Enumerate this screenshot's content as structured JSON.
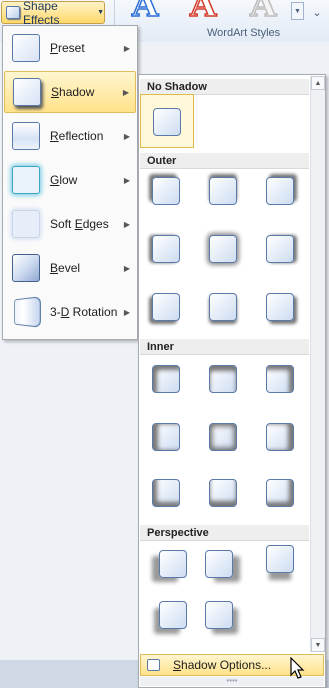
{
  "ribbon": {
    "shape_effects_label": "Shape Effects",
    "wordart_group_label": "WordArt Styles",
    "wordart_letters": [
      "A",
      "A",
      "A"
    ]
  },
  "menu": {
    "items": [
      {
        "label": "Preset",
        "access_key": "P",
        "rest": "reset",
        "icon": "preset-icon"
      },
      {
        "label": "Shadow",
        "access_key": "S",
        "rest": "hadow",
        "icon": "shadow-icon"
      },
      {
        "label": "Reflection",
        "access_key": "R",
        "rest": "eflection",
        "icon": "reflection-icon"
      },
      {
        "label": "Glow",
        "access_key": "G",
        "rest": "low",
        "icon": "glow-icon"
      },
      {
        "label": "Soft Edges",
        "pre": "Soft ",
        "access_key": "E",
        "rest": "dges",
        "icon": "soft-edges-icon"
      },
      {
        "label": "Bevel",
        "access_key": "B",
        "rest": "evel",
        "icon": "bevel-icon"
      },
      {
        "label": "3-D Rotation",
        "pre": "3-",
        "access_key": "D",
        "rest": " Rotation",
        "icon": "3d-rotation-icon"
      }
    ],
    "active_item": "Shadow"
  },
  "shadow_panel": {
    "sections": {
      "no_shadow": "No Shadow",
      "outer": "Outer",
      "inner": "Inner",
      "perspective": "Perspective"
    },
    "options_label": "Shadow Options...",
    "options_access_key": "S"
  },
  "colors": {
    "accent_highlight": "#ffe28a",
    "highlight_border": "#e3bd5b",
    "tile_border": "#5b79a8",
    "wordart_blue": "#2a6fd6",
    "wordart_red": "#d43a2a"
  }
}
